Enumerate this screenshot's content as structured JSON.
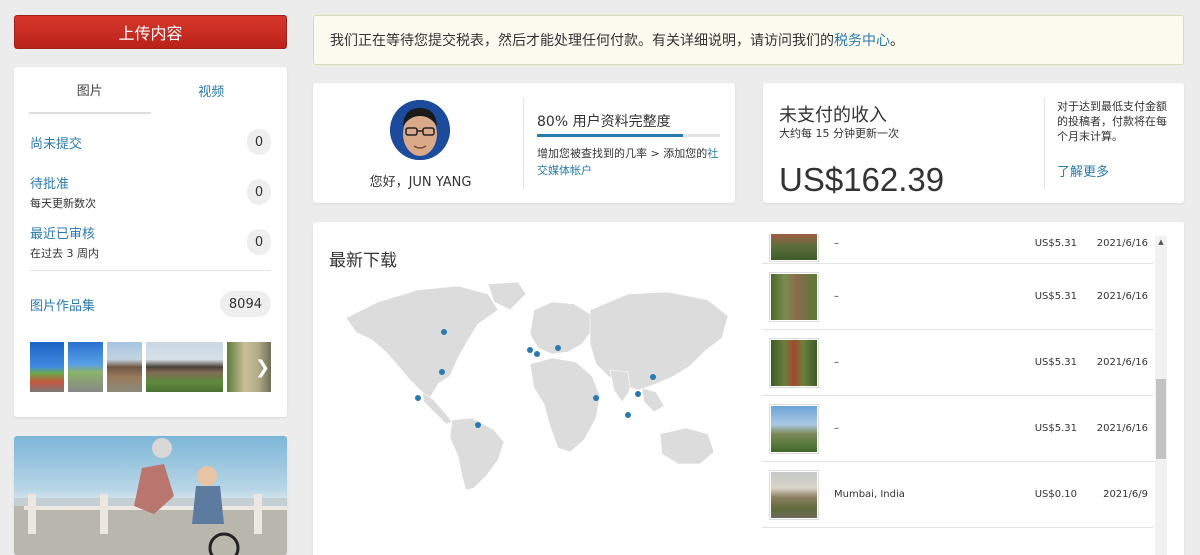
{
  "upload_button": "上传内容",
  "left_panel": {
    "tabs": [
      {
        "label": "图片",
        "active": true
      },
      {
        "label": "视频",
        "active": false
      }
    ],
    "stats": [
      {
        "label": "尚未提交",
        "sub": "",
        "count": "0"
      },
      {
        "label": "待批准",
        "sub": "每天更新数次",
        "count": "0"
      },
      {
        "label": "最近已审核",
        "sub": "在过去 3 周内",
        "count": "0"
      }
    ],
    "portfolio": {
      "label": "图片作品集",
      "count": "8094"
    },
    "next_icon": "chevron-right-icon"
  },
  "notice": {
    "text": "我们正在等待您提交税表，然后才能处理任何付款。有关详细说明，请访问我们的",
    "link": "税务中心",
    "suffix": "。"
  },
  "profile": {
    "greeting": "您好，JUN YANG",
    "completeness_label": "80% 用户资料完整度",
    "completeness_value": 0.8,
    "hint_text": "增加您被查找到的几率 > 添加您的",
    "hint_link": "社交媒体帐户"
  },
  "earnings": {
    "title": "未支付的收入",
    "update_note": "大约每 15 分钟更新一次",
    "amount": "US$162.39",
    "payout_note": "对于达到最低支付金额的投稿者，付款将在每个月末计算。",
    "learn_more": "了解更多"
  },
  "downloads": {
    "title": "最新下载",
    "rows": [
      {
        "location": "–",
        "price": "US$5.31",
        "date": "2021/6/16"
      },
      {
        "location": "–",
        "price": "US$5.31",
        "date": "2021/6/16"
      },
      {
        "location": "–",
        "price": "US$5.31",
        "date": "2021/6/16"
      },
      {
        "location": "–",
        "price": "US$5.31",
        "date": "2021/6/16"
      },
      {
        "location": "Mumbai, India",
        "price": "US$0.10",
        "date": "2021/6/9"
      }
    ]
  },
  "colors": {
    "accent": "#2a7ab0",
    "upload_button": "#c62d22",
    "map_land": "#dcdcdc",
    "map_dot": "#2a7ab0"
  }
}
